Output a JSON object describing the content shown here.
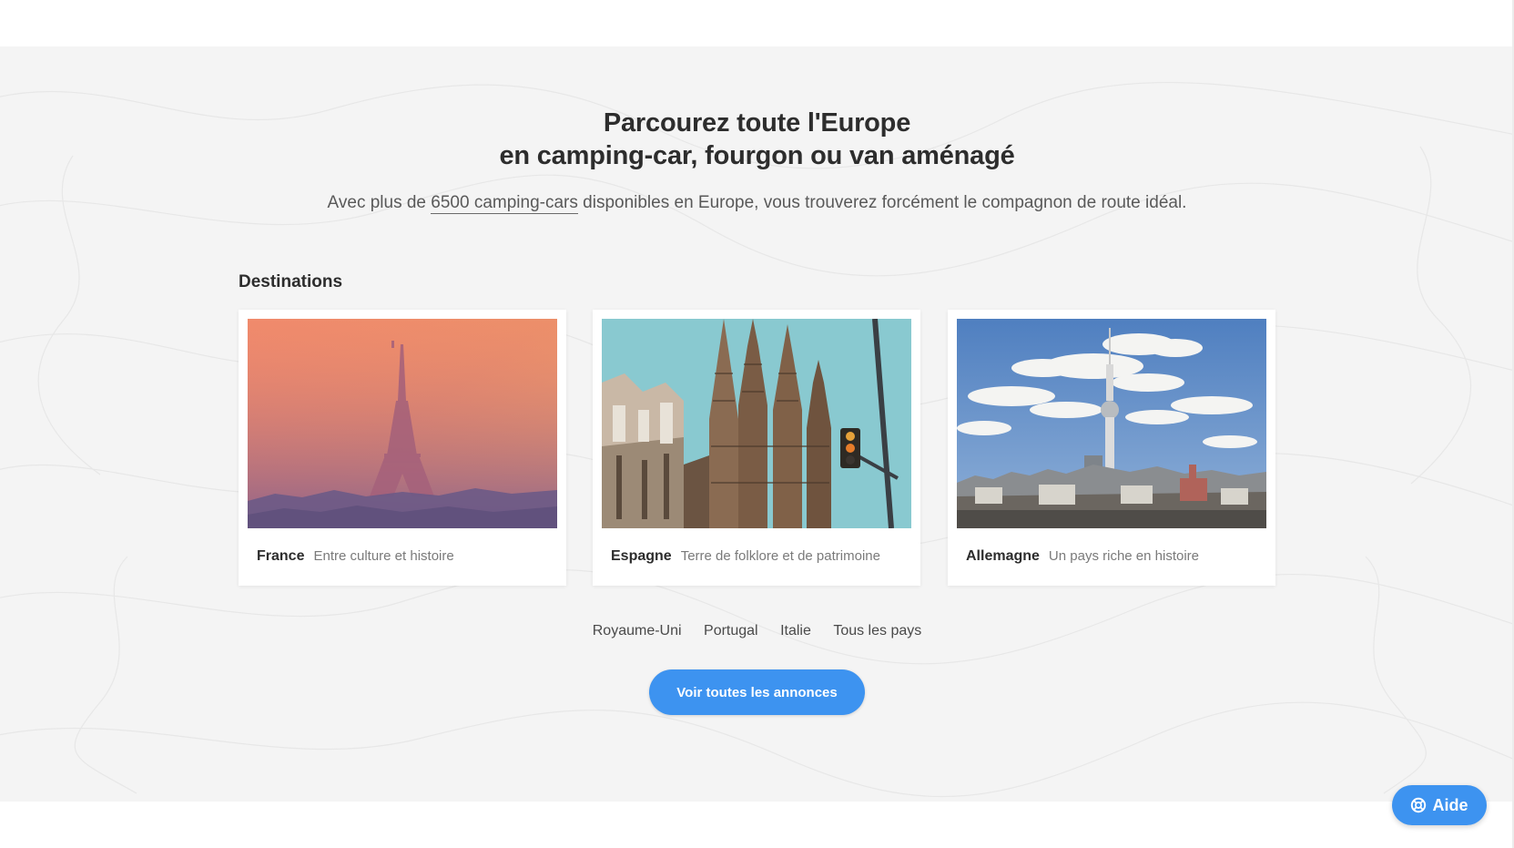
{
  "hero": {
    "title_line1": "Parcourez toute l'Europe",
    "title_line2": "en camping-car, fourgon ou van aménagé",
    "subtitle_before": "Avec plus de ",
    "subtitle_link": "6500 camping-cars",
    "subtitle_after": " disponibles en Europe, vous trouverez forcément le compagnon de route idéal."
  },
  "destinations": {
    "label": "Destinations",
    "cards": [
      {
        "country": "France",
        "description": "Entre culture et histoire",
        "image": "eiffel-tower-photo"
      },
      {
        "country": "Espagne",
        "description": "Terre de folklore et de patrimoine",
        "image": "sagrada-familia-photo"
      },
      {
        "country": "Allemagne",
        "description": "Un pays riche en histoire",
        "image": "berlin-tv-tower-photo"
      }
    ]
  },
  "other_countries": [
    "Royaume-Uni",
    "Portugal",
    "Italie",
    "Tous les pays"
  ],
  "cta": {
    "label": "Voir toutes les annonces"
  },
  "help": {
    "label": "Aide",
    "icon": "lifebuoy-icon"
  },
  "colors": {
    "accent": "#3d93f0",
    "section_bg": "#f4f4f4"
  }
}
